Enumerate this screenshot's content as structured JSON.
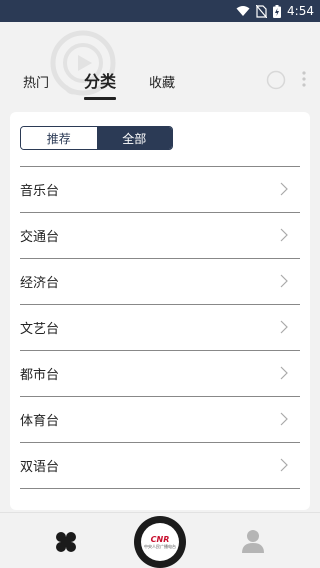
{
  "status": {
    "time": "4:54"
  },
  "tabs": [
    {
      "label": "热门"
    },
    {
      "label": "分类"
    },
    {
      "label": "收藏"
    }
  ],
  "segment": {
    "recommend": "推荐",
    "all": "全部"
  },
  "categories": [
    "音乐台",
    "交通台",
    "经济台",
    "文艺台",
    "都市台",
    "体育台",
    "双语台"
  ],
  "center_logo": {
    "brand": "CNR",
    "sub": "中央人民广播电台"
  },
  "colors": {
    "accent": "#2b3a55",
    "background": "#f2f2f2",
    "card": "#ffffff"
  }
}
